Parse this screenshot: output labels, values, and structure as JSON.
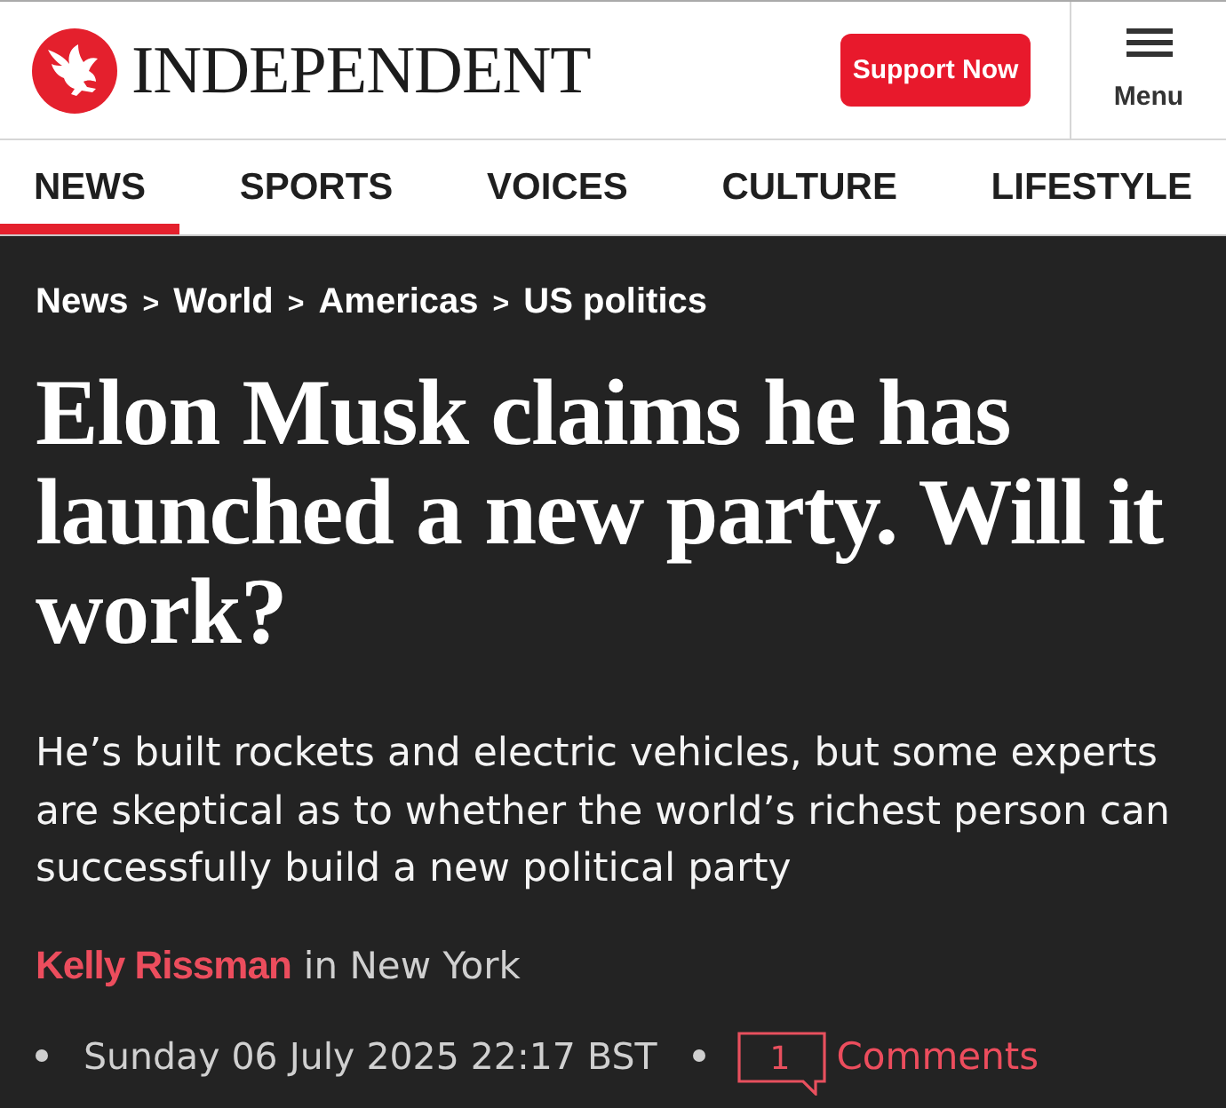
{
  "header": {
    "logo_text": "INDEPENDENT",
    "support_button": "Support Now",
    "menu_label": "Menu"
  },
  "nav": {
    "tabs": [
      {
        "label": "NEWS",
        "selected": true
      },
      {
        "label": "SPORTS",
        "selected": false
      },
      {
        "label": "VOICES",
        "selected": false
      },
      {
        "label": "CULTURE",
        "selected": false
      },
      {
        "label": "LIFESTYLE",
        "selected": false
      }
    ]
  },
  "article": {
    "breadcrumb": [
      {
        "label": "News"
      },
      {
        "separator": ">",
        "label": "World"
      },
      {
        "separator": ">",
        "label": "Americas"
      },
      {
        "separator": ">",
        "label": "US politics"
      }
    ],
    "headline": "Elon Musk claims he has launched a new party. Will it work?",
    "standfirst": "He’s built rockets and electric vehicles, but some experts are skeptical as to whether the world’s richest person can successfully build a new political party",
    "byline": {
      "author": "Kelly Rissman",
      "location": "in New York"
    },
    "dateline": {
      "date": "Sunday 06 July 2025 22:17 BST",
      "comment_count": "1",
      "comments_label": "Comments"
    }
  }
}
